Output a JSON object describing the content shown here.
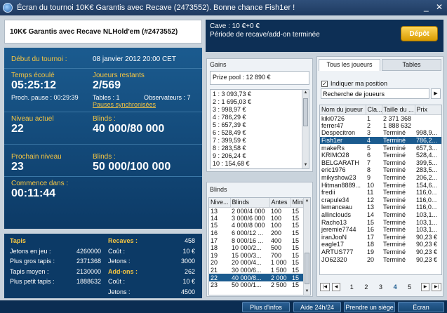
{
  "window": {
    "title": "Écran du tournoi 10K€ Garantis avec Recave (2473552). Bonne chance Fish1er !",
    "minimize": "_",
    "close": "✕"
  },
  "header": {
    "tournament": "10K€ Garantis avec Recave NLHold'em (#2473552)",
    "cave": "Cave : 10 €+0 €",
    "period": "Période de recave/add-on terminée",
    "depot": "Dépôt"
  },
  "info": {
    "start_label": "Début du tournoi :",
    "start_value": "08 janvier 2012  20:00 CET",
    "elapsed_label": "Temps écoulé",
    "elapsed_value": "05:25:12",
    "remaining_label": "Joueurs restants",
    "remaining_value": "2/569",
    "pause": "Proch. pause : 00:29:39",
    "tables": "Tables : 1",
    "observers": "Observateurs : 7",
    "sync": "Pauses synchronisées",
    "level_label": "Niveau actuel",
    "level_value": "22",
    "blinds_label": "Blinds :",
    "blinds_value": "40 000/80 000",
    "next_label": "Prochain niveau",
    "next_value": "23",
    "next_blinds_label": "Blinds :",
    "next_blinds_value": "50 000/100 000",
    "countdown_label": "Commence dans :",
    "countdown_value": "00:11:44"
  },
  "stats": {
    "left": [
      [
        "Tapis",
        ""
      ],
      [
        "Jetons en jeu :",
        "4260000"
      ],
      [
        "Plus gros tapis :",
        "2371368"
      ],
      [
        "Tapis moyen :",
        "2130000"
      ],
      [
        "Plus petit tapis :",
        "1888632"
      ]
    ],
    "right": [
      [
        "Recaves :",
        "458"
      ],
      [
        "Coût :",
        "10 €"
      ],
      [
        "Jetons :",
        "3000"
      ],
      [
        "Add-ons :",
        "262"
      ],
      [
        "Coût :",
        "10 €"
      ],
      [
        "Jetons :",
        "4500"
      ]
    ]
  },
  "gains": {
    "title": "Gains",
    "pool": "Prize pool : 12 890 €",
    "items": [
      "1 : 3 093,73 €",
      "2 : 1 695,03 €",
      "3 : 998,97 €",
      "4 : 786,29 €",
      "5 : 657,39 €",
      "6 : 528,49 €",
      "7 : 399,59 €",
      "8 : 283,58 €",
      "9 : 206,24 €",
      "10 : 154,68 €"
    ]
  },
  "blinds": {
    "title": "Blinds",
    "headers": [
      "Nive...",
      "Blinds",
      "Antes",
      "Mini"
    ],
    "rows": [
      [
        "13",
        "2 000/4 000",
        "100",
        "15"
      ],
      [
        "14",
        "3 000/6 000",
        "100",
        "15"
      ],
      [
        "15",
        "4 000/8 000",
        "100",
        "15"
      ],
      [
        "16",
        "6 000/12 ...",
        "200",
        "15"
      ],
      [
        "17",
        "8 000/16 ...",
        "400",
        "15"
      ],
      [
        "18",
        "10 000/2...",
        "500",
        "15"
      ],
      [
        "19",
        "15 000/3...",
        "700",
        "15"
      ],
      [
        "20",
        "20 000/4...",
        "1 000",
        "15"
      ],
      [
        "21",
        "30 000/6...",
        "1 500",
        "15"
      ],
      [
        "22",
        "40 000/8...",
        "2 000",
        "15"
      ],
      [
        "23",
        "50 000/1...",
        "2 500",
        "15"
      ]
    ],
    "selected": 9
  },
  "players": {
    "tab_all": "Tous les joueurs",
    "tab_tables": "Tables",
    "indicate": "Indiquer ma position",
    "search": "Recherche de joueurs",
    "headers": [
      "Nom du joueur",
      "Cla...",
      "Taille du ...",
      "Prix"
    ],
    "rows": [
      [
        "kiki0726",
        "1",
        "2 371 368",
        ""
      ],
      [
        "ferrer47",
        "2",
        "1 888 632",
        ""
      ],
      [
        "Despecitron",
        "3",
        "Terminé",
        "998,9..."
      ],
      [
        "Fish1er",
        "4",
        "Terminé",
        "786,2..."
      ],
      [
        "makeRs",
        "5",
        "Terminé",
        "657,3..."
      ],
      [
        "KRIMO28",
        "6",
        "Terminé",
        "528,4..."
      ],
      [
        "BELGARATH",
        "7",
        "Terminé",
        "399,5..."
      ],
      [
        "eric1976",
        "8",
        "Terminé",
        "283,5..."
      ],
      [
        "mikyshow23",
        "9",
        "Terminé",
        "206,2..."
      ],
      [
        "Hitman8889...",
        "10",
        "Terminé",
        "154,6..."
      ],
      [
        "fredii",
        "11",
        "Terminé",
        "116,0..."
      ],
      [
        "crapule34",
        "12",
        "Terminé",
        "116,0..."
      ],
      [
        "lemanceau",
        "13",
        "Terminé",
        "116,0..."
      ],
      [
        "allinclouds",
        "14",
        "Terminé",
        "103,1..."
      ],
      [
        "Racho13",
        "15",
        "Terminé",
        "103,1..."
      ],
      [
        "jeremie7744",
        "16",
        "Terminé",
        "103,1..."
      ],
      [
        "iranJooN",
        "17",
        "Terminé",
        "90,23 €"
      ],
      [
        "eagle17",
        "18",
        "Terminé",
        "90,23 €"
      ],
      [
        "ARTUS777",
        "19",
        "Terminé",
        "90,23 €"
      ],
      [
        "JO62320",
        "20",
        "Terminé",
        "90,23 €"
      ]
    ],
    "selected": 3,
    "pages": [
      "1",
      "2",
      "3",
      "4",
      "5"
    ],
    "current_page": "4"
  },
  "bottom": {
    "infos": "Plus d'infos",
    "help": "Aide 24h/24",
    "seat": "Prendre un siège",
    "lobby": "Écran"
  }
}
